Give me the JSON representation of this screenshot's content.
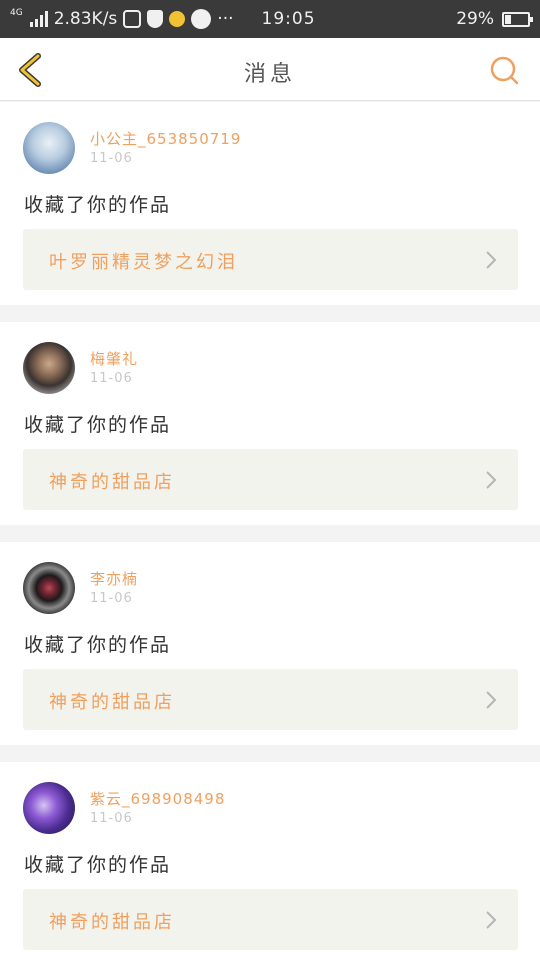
{
  "status_bar": {
    "network": "4G",
    "speed": "2.83K/s",
    "time": "19:05",
    "battery": "29%",
    "battery_fraction": 0.29
  },
  "header": {
    "title": "消息",
    "back_icon": "chevron-left-icon",
    "search_icon": "search-icon",
    "accent_color": "#f0a05e"
  },
  "messages": [
    {
      "user": "小公主_653850719",
      "date": "11-06",
      "action": "收藏了你的作品",
      "work_title": "叶罗丽精灵梦之幻泪"
    },
    {
      "user": "梅肇礼",
      "date": "11-06",
      "action": "收藏了你的作品",
      "work_title": "神奇的甜品店"
    },
    {
      "user": "李亦楠",
      "date": "11-06",
      "action": "收藏了你的作品",
      "work_title": "神奇的甜品店"
    },
    {
      "user": "紫云_698908498",
      "date": "11-06",
      "action": "收藏了你的作品",
      "work_title": "神奇的甜品店"
    }
  ]
}
